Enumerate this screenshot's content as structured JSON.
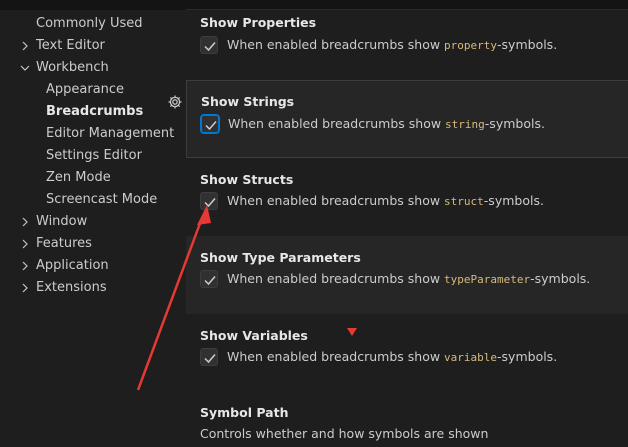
{
  "toc": {
    "items": [
      {
        "label": "Commonly Used",
        "expandable": false,
        "expanded": false,
        "active": false,
        "level": 0
      },
      {
        "label": "Text Editor",
        "expandable": true,
        "expanded": false,
        "active": false,
        "level": 0
      },
      {
        "label": "Workbench",
        "expandable": true,
        "expanded": true,
        "active": false,
        "level": 0
      },
      {
        "label": "Appearance",
        "expandable": false,
        "expanded": false,
        "active": false,
        "level": 1
      },
      {
        "label": "Breadcrumbs",
        "expandable": false,
        "expanded": false,
        "active": true,
        "level": 1
      },
      {
        "label": "Editor Management",
        "expandable": false,
        "expanded": false,
        "active": false,
        "level": 1
      },
      {
        "label": "Settings Editor",
        "expandable": false,
        "expanded": false,
        "active": false,
        "level": 1
      },
      {
        "label": "Zen Mode",
        "expandable": false,
        "expanded": false,
        "active": false,
        "level": 1
      },
      {
        "label": "Screencast Mode",
        "expandable": false,
        "expanded": false,
        "active": false,
        "level": 1
      },
      {
        "label": "Window",
        "expandable": true,
        "expanded": false,
        "active": false,
        "level": 0
      },
      {
        "label": "Features",
        "expandable": true,
        "expanded": false,
        "active": false,
        "level": 0
      },
      {
        "label": "Application",
        "expandable": true,
        "expanded": false,
        "active": false,
        "level": 0
      },
      {
        "label": "Extensions",
        "expandable": true,
        "expanded": false,
        "active": false,
        "level": 0
      }
    ]
  },
  "settings": [
    {
      "title": "Show Properties",
      "desc_pre": "When enabled breadcrumbs show ",
      "code": "property",
      "desc_post": "-symbols.",
      "checked": true
    },
    {
      "title": "Show Strings",
      "desc_pre": "When enabled breadcrumbs show ",
      "code": "string",
      "desc_post": "-symbols.",
      "checked": true
    },
    {
      "title": "Show Structs",
      "desc_pre": "When enabled breadcrumbs show ",
      "code": "struct",
      "desc_post": "-symbols.",
      "checked": true
    },
    {
      "title": "Show Type Parameters",
      "desc_pre": "When enabled breadcrumbs show ",
      "code": "typeParameter",
      "desc_post": "-symbols.",
      "checked": true
    },
    {
      "title": "Show Variables",
      "desc_pre": "When enabled breadcrumbs show ",
      "code": "variable",
      "desc_post": "-symbols.",
      "checked": true
    }
  ],
  "symbol_path": {
    "title": "Symbol Path",
    "description": "Controls whether and how symbols are shown"
  },
  "colors": {
    "background": "#1e1e1e",
    "focused_row": "#262626",
    "accent": "#0078d4",
    "code_text": "#d7ba7d",
    "annotation": "#e53935"
  },
  "icons": {
    "gear": "gear-icon",
    "chevron_right": "chevron-right-icon",
    "chevron_down": "chevron-down-icon",
    "check": "check-icon"
  }
}
